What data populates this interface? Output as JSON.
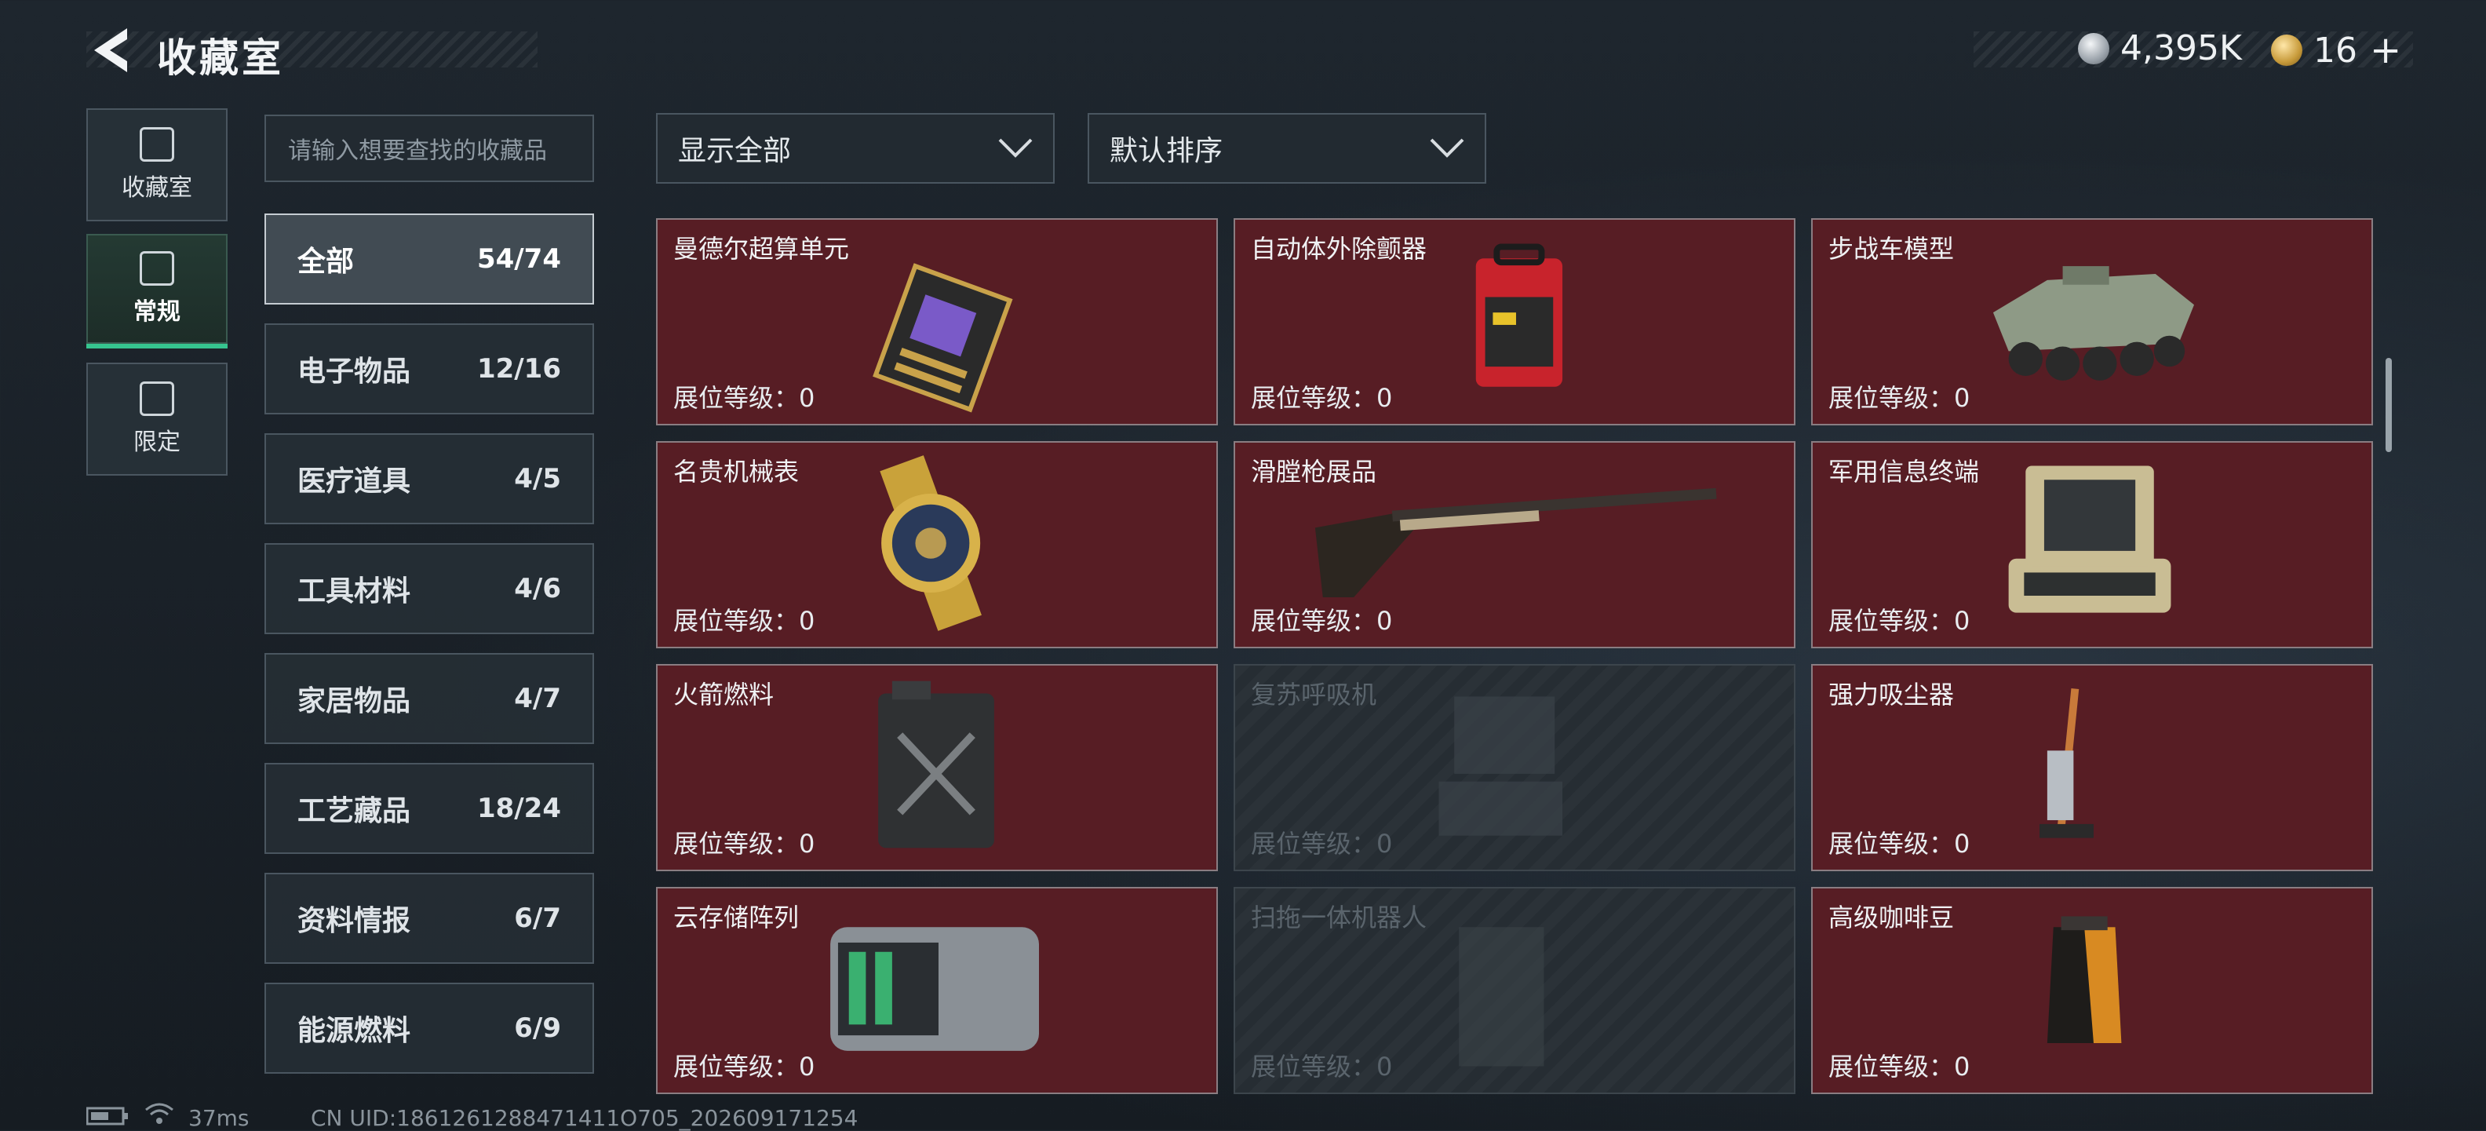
{
  "header": {
    "title": "收藏室"
  },
  "currencies": [
    {
      "icon": "silver-coin-icon",
      "value": "4,395K"
    },
    {
      "icon": "gold-coin-icon",
      "value": "16",
      "plus": "+"
    }
  ],
  "modes": [
    {
      "label": "收藏室",
      "icon": "vault-icon",
      "active": false
    },
    {
      "label": "常规",
      "icon": "picture-icon",
      "active": true
    },
    {
      "label": "限定",
      "icon": "gallery-icon",
      "active": false
    }
  ],
  "search": {
    "placeholder": "请输入想要查找的收藏品"
  },
  "categories": [
    {
      "label": "全部",
      "count": "54/74"
    },
    {
      "label": "电子物品",
      "count": "12/16"
    },
    {
      "label": "医疗道具",
      "count": "4/5"
    },
    {
      "label": "工具材料",
      "count": "4/6"
    },
    {
      "label": "家居物品",
      "count": "4/7"
    },
    {
      "label": "工艺藏品",
      "count": "18/24"
    },
    {
      "label": "资料情报",
      "count": "6/7"
    },
    {
      "label": "能源燃料",
      "count": "6/9"
    }
  ],
  "filters": {
    "show": "显示全部",
    "sort": "默认排序"
  },
  "items": [
    {
      "name": "曼德尔超算单元",
      "level": "展位等级：0",
      "locked": false,
      "icon": "supercomputer-unit-icon"
    },
    {
      "name": "自动体外除颤器",
      "level": "展位等级：0",
      "locked": false,
      "icon": "defibrillator-icon"
    },
    {
      "name": "步战车模型",
      "level": "展位等级：0",
      "locked": false,
      "icon": "ifv-model-icon"
    },
    {
      "name": "名贵机械表",
      "level": "展位等级：0",
      "locked": false,
      "icon": "mechanical-watch-icon"
    },
    {
      "name": "滑膛枪展品",
      "level": "展位等级：0",
      "locked": false,
      "icon": "musket-icon"
    },
    {
      "name": "军用信息终端",
      "level": "展位等级：0",
      "locked": false,
      "icon": "military-terminal-icon"
    },
    {
      "name": "火箭燃料",
      "level": "展位等级：0",
      "locked": false,
      "icon": "fuel-can-icon"
    },
    {
      "name": "复苏呼吸机",
      "level": "展位等级：0",
      "locked": true,
      "icon": "ventilator-icon"
    },
    {
      "name": "强力吸尘器",
      "level": "展位等级：0",
      "locked": false,
      "icon": "vacuum-cleaner-icon"
    },
    {
      "name": "云存储阵列",
      "level": "展位等级：0",
      "locked": false,
      "icon": "storage-array-icon"
    },
    {
      "name": "扫拖一体机器人",
      "level": "展位等级：0",
      "locked": true,
      "icon": "robot-mop-icon"
    },
    {
      "name": "高级咖啡豆",
      "level": "展位等级：0",
      "locked": false,
      "icon": "coffee-bag-icon"
    }
  ],
  "status": {
    "ping": "37ms",
    "uid": "CN UID:1861261288471411O705_202609171254"
  }
}
